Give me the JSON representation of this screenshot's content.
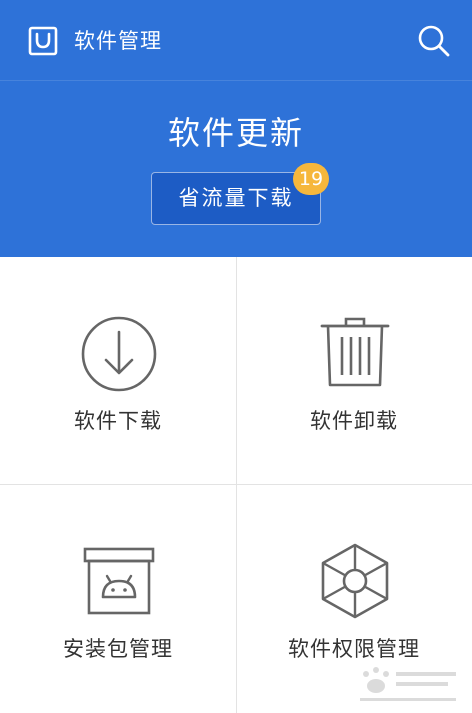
{
  "header": {
    "title": "软件管理",
    "logo_icon": "shopping-bag-icon",
    "search_icon": "search-icon"
  },
  "hero": {
    "title": "软件更新",
    "button_label": "省流量下载",
    "badge_count": "19"
  },
  "grid": {
    "items": [
      {
        "label": "软件下载",
        "icon": "download-circle-icon"
      },
      {
        "label": "软件卸载",
        "icon": "trash-can-icon"
      },
      {
        "label": "安装包管理",
        "icon": "android-package-icon"
      },
      {
        "label": "软件权限管理",
        "icon": "aperture-icon"
      }
    ]
  },
  "colors": {
    "primary": "#2e72d8",
    "button": "#1d5cc5",
    "badge": "#f6b73c",
    "text": "#333333",
    "icon": "#666666"
  }
}
